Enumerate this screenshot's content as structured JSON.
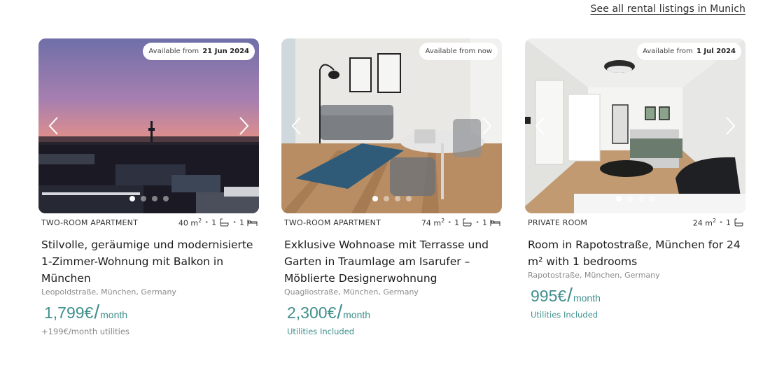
{
  "see_all_link": "See all rental listings in Munich",
  "listings": [
    {
      "availability_prefix": "Available from",
      "availability_date": "21 Jun 2024",
      "type": "TWO-ROOM APARTMENT",
      "area": "40",
      "area_unit": "m",
      "area_sup": "2",
      "bathrooms": "1",
      "bedrooms": "1",
      "title": "Stilvolle, geräumige und modernisierte 1-Zimmer-Wohnung mit Balkon in München",
      "address": "Leopoldstraße, München, Germany",
      "price": "1,799€",
      "price_slash": "/",
      "price_period": "month",
      "extra": "+199€/month utilities",
      "image_dots": 4,
      "active_dot": 0,
      "image_icon": "sunset-city-skyline-photo"
    },
    {
      "availability_prefix": "Available from now",
      "availability_date": "",
      "type": "TWO-ROOM APARTMENT",
      "area": "74",
      "area_unit": "m",
      "area_sup": "2",
      "bathrooms": "1",
      "bedrooms": "1",
      "title": "Exklusive Wohnoase mit Terrasse und Garten in Traumlage am Isarufer – Möblierte Designerwohnung",
      "address": "Quagliostraße, München, Germany",
      "price": "2,300€",
      "price_slash": "/",
      "price_period": "month",
      "extra": "Utilities Included",
      "image_dots": 4,
      "active_dot": 0,
      "image_icon": "living-room-photo"
    },
    {
      "availability_prefix": "Available from",
      "availability_date": "1 Jul 2024",
      "type": "PRIVATE ROOM",
      "area": "24",
      "area_unit": "m",
      "area_sup": "2",
      "bathrooms": "1",
      "title": "Room in Rapotostraße, München for 24 m² with 1 bedrooms",
      "address": "Rapotostraße, München, Germany",
      "price": "995€",
      "price_slash": "/",
      "price_period": "month",
      "extra": "Utilities Included",
      "image_dots": 4,
      "active_dot": 0,
      "image_icon": "bedroom-photo"
    }
  ],
  "colors": {
    "price_accent": "#3f8f8c",
    "muted_text": "#8a8a8a"
  }
}
